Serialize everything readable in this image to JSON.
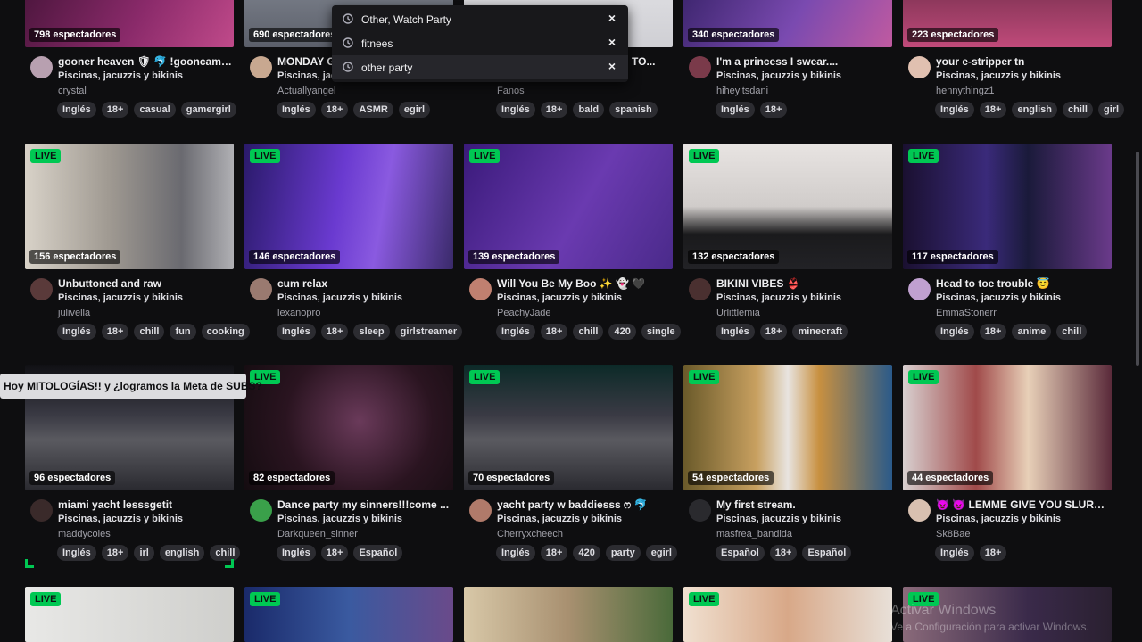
{
  "dropdown": {
    "items": [
      {
        "label": "Other, Watch Party"
      },
      {
        "label": "fitnees"
      },
      {
        "label": "other party"
      }
    ],
    "remove_glyph": "×"
  },
  "tooltip": {
    "text": "Hoy MITOLOGÍAS!! y ¿logramos la Meta de SUBS?"
  },
  "live_label": "LIVE",
  "rows": [
    {
      "cards": [
        {
          "viewers": "798 espectadores",
          "title": "gooner heaven 🛡 🐬 !gooncam ...",
          "category": "Piscinas, jacuzzis y bikinis",
          "user": "crystal",
          "tags": [
            "Inglés",
            "18+",
            "casual",
            "gamergirl"
          ],
          "color": "#6b2a4a"
        },
        {
          "viewers": "690 espectadores",
          "title": "MONDAY G",
          "category": "Piscinas, jacu",
          "user": "Actuallyangel",
          "tags": [
            "Inglés",
            "18+",
            "ASMR",
            "egirl"
          ],
          "color": "#5b5f6a"
        },
        {
          "viewers": "",
          "title": "TO...",
          "category": "",
          "user": "Fanos",
          "tags": [
            "Inglés",
            "18+",
            "bald",
            "spanish"
          ],
          "color": "#d8d8dc"
        },
        {
          "viewers": "340 espectadores",
          "title": "I'm a princess I swear....",
          "category": "Piscinas, jacuzzis y bikinis",
          "user": "hiheyitsdani",
          "tags": [
            "Inglés",
            "18+"
          ],
          "color": "#5a4a9a"
        },
        {
          "viewers": "223 espectadores",
          "title": "your e-stripper tn",
          "category": "Piscinas, jacuzzis y bikinis",
          "user": "hennythingz1",
          "tags": [
            "Inglés",
            "18+",
            "english",
            "chill",
            "girl"
          ],
          "color": "#8a3a5a"
        }
      ]
    },
    {
      "cards": [
        {
          "live": true,
          "viewers": "156 espectadores",
          "title": "Unbuttoned and raw",
          "category": "Piscinas, jacuzzis y bikinis",
          "user": "julivella",
          "tags": [
            "Inglés",
            "18+",
            "chill",
            "fun",
            "cooking"
          ],
          "color": "#8a8682"
        },
        {
          "live": true,
          "viewers": "146 espectadores",
          "title": "cum relax",
          "category": "Piscinas, jacuzzis y bikinis",
          "user": "lexanopro",
          "tags": [
            "Inglés",
            "18+",
            "sleep",
            "girlstreamer"
          ],
          "color": "#5a32a8"
        },
        {
          "live": true,
          "viewers": "139 espectadores",
          "title": "Will You Be My Boo ✨ 👻 🖤",
          "category": "Piscinas, jacuzzis y bikinis",
          "user": "PeachyJade",
          "tags": [
            "Inglés",
            "18+",
            "chill",
            "420",
            "single"
          ],
          "color": "#4a2a8a"
        },
        {
          "live": true,
          "viewers": "132 espectadores",
          "title": "BIKINI VIBES 👙",
          "category": "Piscinas, jacuzzis y bikinis",
          "user": "Urlittlemia",
          "tags": [
            "Inglés",
            "18+",
            "minecraft"
          ],
          "color": "#d8d4d2"
        },
        {
          "live": true,
          "viewers": "117 espectadores",
          "title": "Head to toe trouble 😇",
          "category": "Piscinas, jacuzzis y bikinis",
          "user": "EmmaStonerr",
          "tags": [
            "Inglés",
            "18+",
            "anime",
            "chill"
          ],
          "color": "#3a2a6a"
        }
      ]
    },
    {
      "cards": [
        {
          "live": false,
          "viewers": "96 espectadores",
          "title": "miami yacht lesssgetit",
          "category": "Piscinas, jacuzzis y bikinis",
          "user": "maddycoles",
          "tags": [
            "Inglés",
            "18+",
            "irl",
            "english",
            "chill"
          ],
          "color": "#2a2a30"
        },
        {
          "live": true,
          "viewers": "82 espectadores",
          "title": "Dance party my sinners!!!come ...",
          "category": "Piscinas, jacuzzis y bikinis",
          "user": "Darkqueen_sinner",
          "tags": [
            "Inglés",
            "18+",
            "Español"
          ],
          "color": "#1e1418"
        },
        {
          "live": true,
          "viewers": "70 espectadores",
          "title": "yacht party w baddiesss ෆ 🐬",
          "category": "Piscinas, jacuzzis y bikinis",
          "user": "Cherryxcheech",
          "tags": [
            "Inglés",
            "18+",
            "420",
            "party",
            "egirl"
          ],
          "color": "#2a2a30"
        },
        {
          "live": true,
          "viewers": "54 espectadores",
          "title": "My first stream.",
          "category": "Piscinas, jacuzzis y bikinis",
          "user": "masfrea_bandida",
          "tags": [
            "Español",
            "18+",
            "Español"
          ],
          "color": "#2a4a6a"
        },
        {
          "live": true,
          "viewers": "44 espectadores",
          "title": "😈 😈 LEMME GIVE YOU SLURP ...",
          "category": "Piscinas, jacuzzis y bikinis",
          "user": "Sk8Bae",
          "tags": [
            "Inglés",
            "18+"
          ],
          "color": "#6a3a3a"
        }
      ]
    },
    {
      "cards": [
        {
          "live": true,
          "color": "#dcdcda"
        },
        {
          "live": true,
          "color": "#2a3a7a"
        },
        {
          "live": false,
          "color": "#b8a890"
        },
        {
          "live": true,
          "color": "#c8a898"
        },
        {
          "live": true,
          "color": "#5a4a6a"
        }
      ]
    }
  ],
  "watermark": {
    "line1": "Activar Windows",
    "line2": "Ve a Configuración para activar Windows."
  }
}
